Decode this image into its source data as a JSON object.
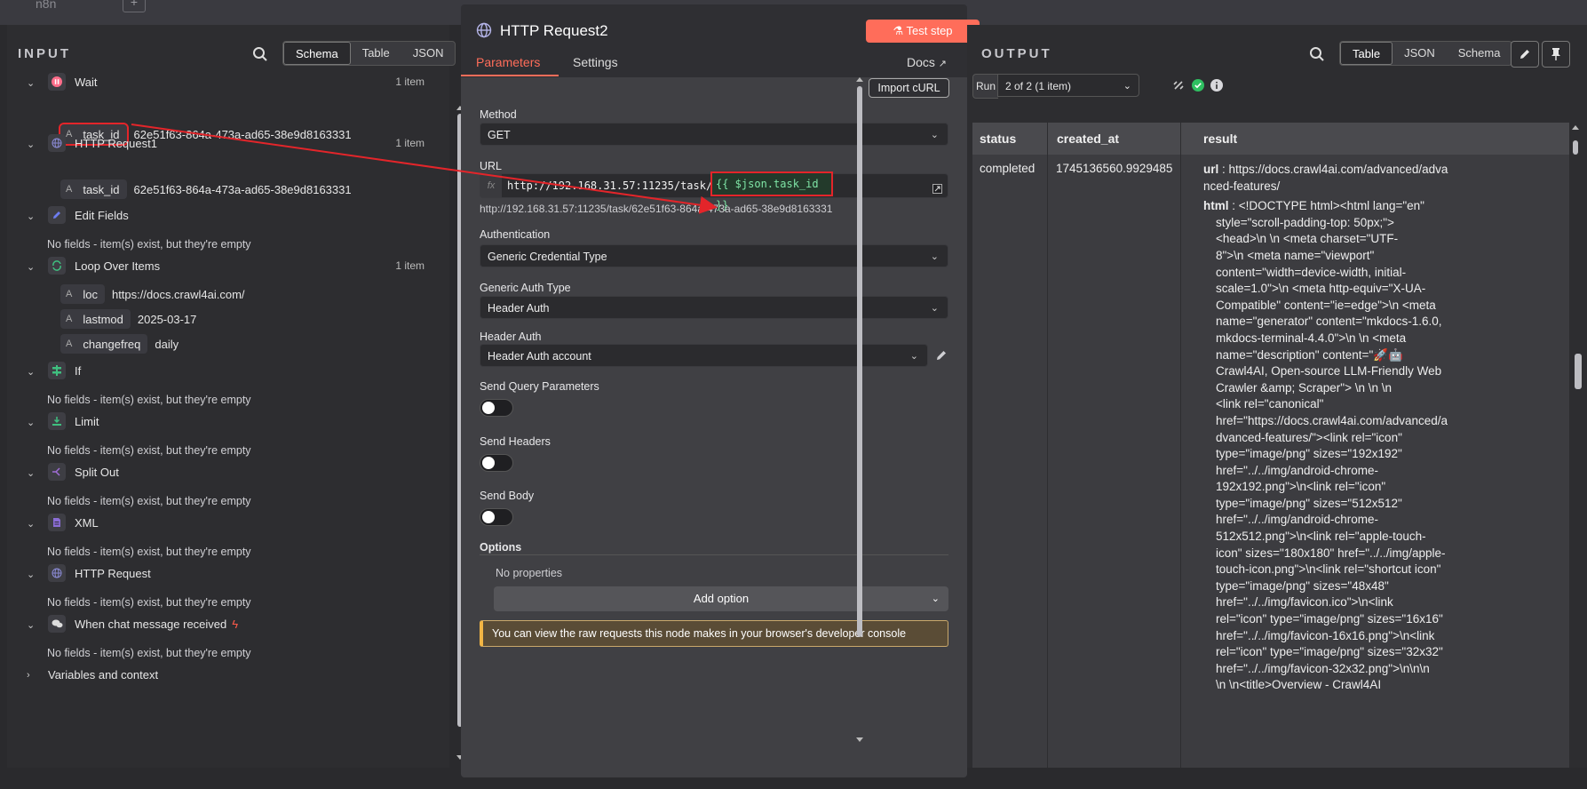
{
  "topbar": {
    "title": "n8n"
  },
  "input": {
    "title": "INPUT",
    "view_tabs": [
      "Schema",
      "Table",
      "JSON"
    ],
    "active_view": "Schema",
    "nodes": [
      {
        "name": "Wait",
        "count": "1 item",
        "icon": "pause-icon",
        "color": "#ff6d8a"
      },
      {
        "name": "HTTP Request1",
        "count": "1 item",
        "icon": "globe-icon",
        "color": "#8b8bd6"
      },
      {
        "name": "Edit Fields",
        "count": "",
        "icon": "pencil-icon",
        "color": "#6d7df0"
      },
      {
        "name": "Loop Over Items",
        "count": "1 item",
        "icon": "loop-icon",
        "color": "#3fbf7f"
      },
      {
        "name": "If",
        "count": "",
        "icon": "branch-icon",
        "color": "#3fbf7f"
      },
      {
        "name": "Limit",
        "count": "",
        "icon": "limit-icon",
        "color": "#3fbf7f"
      },
      {
        "name": "Split Out",
        "count": "",
        "icon": "split-icon",
        "color": "#a06dd6"
      },
      {
        "name": "XML",
        "count": "",
        "icon": "file-icon",
        "color": "#8b6dd6"
      },
      {
        "name": "HTTP Request",
        "count": "",
        "icon": "globe-icon",
        "color": "#8b8bd6"
      },
      {
        "name": "When chat message received",
        "count": "",
        "icon": "chat-icon",
        "color": "#dddddd"
      }
    ],
    "fields": {
      "wait_task_id": {
        "key": "task_id",
        "value": "62e51f63-864a-473a-ad65-38e9d8163331"
      },
      "http1_task_id": {
        "key": "task_id",
        "value": "62e51f63-864a-473a-ad65-38e9d8163331"
      },
      "loc": {
        "key": "loc",
        "value": "https://docs.crawl4ai.com/"
      },
      "lastmod": {
        "key": "lastmod",
        "value": "2025-03-17"
      },
      "changefreq": {
        "key": "changefreq",
        "value": "daily"
      }
    },
    "field_type": "A",
    "empty_text": "No fields - item(s) exist, but they're empty",
    "variables": "Variables and context"
  },
  "node": {
    "title": "HTTP Request2",
    "test_step": "Test step",
    "tabs": [
      "Parameters",
      "Settings"
    ],
    "docs": "Docs",
    "import_curl": "Import cURL",
    "method_label": "Method",
    "method_value": "GET",
    "url_label": "URL",
    "url_fx": "fx",
    "url_static": "http://192.168.31.57:11235/task/",
    "url_expression": "{{ $json.task_id }}",
    "url_resolved": "http://192.168.31.57:11235/task/62e51f63-864a-473a-ad65-38e9d8163331",
    "auth_label": "Authentication",
    "auth_value": "Generic Credential Type",
    "generic_auth_label": "Generic Auth Type",
    "generic_auth_value": "Header Auth",
    "header_auth_label": "Header Auth",
    "header_auth_value": "Header Auth account",
    "send_query_label": "Send Query Parameters",
    "send_headers_label": "Send Headers",
    "send_body_label": "Send Body",
    "options_label": "Options",
    "no_properties": "No properties",
    "add_option": "Add option",
    "notice": "You can view the raw requests this node makes in your browser's developer console"
  },
  "output": {
    "title": "OUTPUT",
    "view_tabs": [
      "Table",
      "JSON",
      "Schema"
    ],
    "active_view": "Table",
    "run_label": "Run",
    "run_value": "2 of 2 (1 item)",
    "columns": [
      "status",
      "created_at",
      "result"
    ],
    "row": {
      "status": "completed",
      "created_at": "1745136560.9929485"
    },
    "result_url_key": "url",
    "result_url_value": "https://docs.crawl4ai.com/advanced/adva nced-features/",
    "result_html_key": "html",
    "result_html_lines": [
      "<!DOCTYPE html><html lang=\"en\"",
      "style=\"scroll-padding-top: 50px;\">",
      "<head>\\n  \\n    <meta charset=\"UTF-",
      "8\">\\n    <meta name=\"viewport\"",
      "content=\"width=device-width, initial-",
      "scale=1.0\">\\n    <meta http-equiv=\"X-UA-",
      "Compatible\" content=\"ie=edge\">\\n    <meta",
      "name=\"generator\" content=\"mkdocs-1.6.0,",
      "mkdocs-terminal-4.4.0\">\\n    \\n    <meta",
      "name=\"description\" content=\"🚀🤖",
      "Crawl4AI, Open-source LLM-Friendly Web",
      "Crawler &amp; Scraper\"> \\n    \\n    \\n",
      "<link rel=\"canonical\"",
      "href=\"https://docs.crawl4ai.com/advanced/a",
      "dvanced-features/\"><link rel=\"icon\"",
      "type=\"image/png\" sizes=\"192x192\"",
      "href=\"../../img/android-chrome-",
      "192x192.png\">\\n<link rel=\"icon\"",
      "type=\"image/png\" sizes=\"512x512\"",
      "href=\"../../img/android-chrome-",
      "512x512.png\">\\n<link rel=\"apple-touch-",
      "icon\" sizes=\"180x180\" href=\"../../img/apple-",
      "touch-icon.png\">\\n<link rel=\"shortcut icon\"",
      "type=\"image/png\" sizes=\"48x48\"",
      "href=\"../../img/favicon.ico\">\\n<link",
      "rel=\"icon\" type=\"image/png\" sizes=\"16x16\"",
      "href=\"../../img/favicon-16x16.png\">\\n<link",
      "rel=\"icon\" type=\"image/png\" sizes=\"32x32\"",
      "href=\"../../img/favicon-32x32.png\">\\n\\n\\n",
      "\\n \\n<title>Overview - Crawl4AI"
    ]
  },
  "colors": {
    "accent": "#ff6d5a",
    "highlight": "#e3252a",
    "expression": "#7fe5a6",
    "success": "#2fbf61"
  }
}
